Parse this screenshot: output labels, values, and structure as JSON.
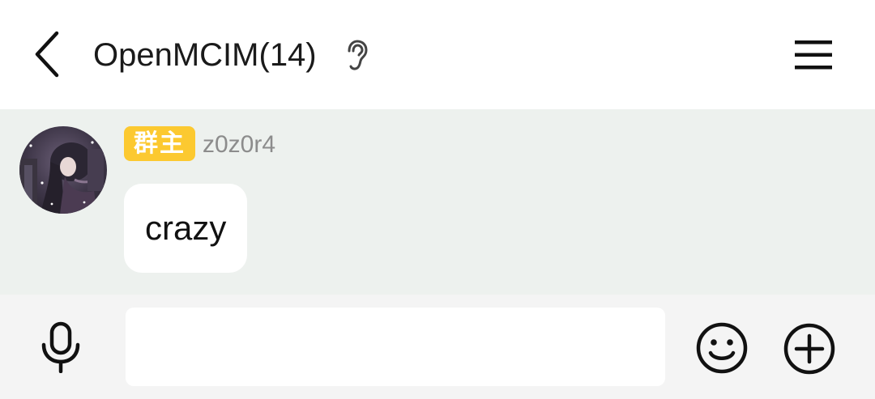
{
  "header": {
    "title": "OpenMCIM(14)",
    "icons": {
      "back": "back-arrow-icon",
      "mode": "ear-icon",
      "menu": "menu-icon"
    }
  },
  "messages": [
    {
      "role_badge": "群主",
      "sender": "z0z0r4",
      "text": "crazy",
      "avatar": "anime-avatar"
    }
  ],
  "input_bar": {
    "value": "",
    "placeholder": "",
    "icons": {
      "voice": "microphone-icon",
      "emoji": "smiley-face-icon",
      "more": "plus-circle-icon"
    }
  },
  "colors": {
    "header_bg": "#ffffff",
    "chat_bg": "#edf1ee",
    "input_bar_bg": "#f4f4f4",
    "badge_bg": "#fcc930",
    "badge_text": "#ffffff",
    "sender_text": "#8c8c8c",
    "bubble_bg": "#ffffff",
    "icon_color": "#111111"
  }
}
